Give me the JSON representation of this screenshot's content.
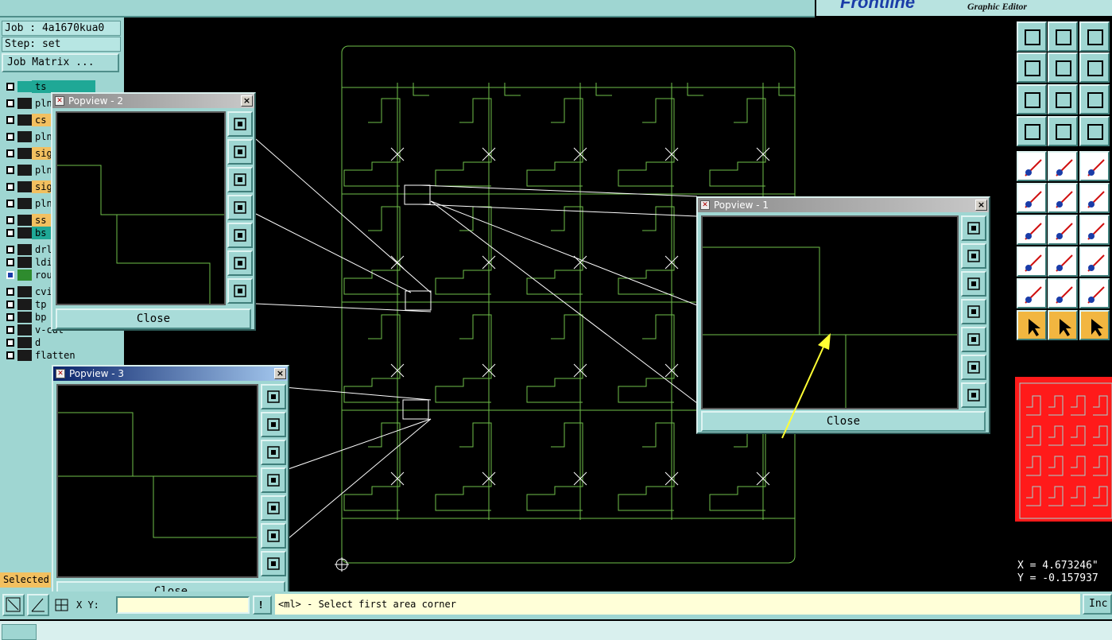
{
  "app": {
    "brand_logo": "Frontline",
    "brand_subtitle": "Graphic Editor"
  },
  "job": {
    "job_line": "Job : 4a1670kua0",
    "step_line": "Step: set",
    "matrix_button": "Job Matrix ..."
  },
  "layers": [
    {
      "name": "ts",
      "swatch": "#1fa896",
      "bg": "#1fa896",
      "checked": false
    },
    {
      "name": "pln",
      "swatch": "#1a1a1a",
      "bg": "#9fd6d2",
      "checked": false
    },
    {
      "name": "cs",
      "swatch": "#1a1a1a",
      "bg": "#f2c060",
      "checked": false
    },
    {
      "name": "pln",
      "swatch": "#1a1a1a",
      "bg": "#9fd6d2",
      "checked": false
    },
    {
      "name": "sig",
      "swatch": "#1a1a1a",
      "bg": "#f2c060",
      "checked": false
    },
    {
      "name": "pln",
      "swatch": "#1a1a1a",
      "bg": "#9fd6d2",
      "checked": false
    },
    {
      "name": "sig",
      "swatch": "#1a1a1a",
      "bg": "#f2c060",
      "checked": false
    },
    {
      "name": "pln",
      "swatch": "#1a1a1a",
      "bg": "#9fd6d2",
      "checked": false
    },
    {
      "name": "ss",
      "swatch": "#1a1a1a",
      "bg": "#f2c060",
      "checked": false
    },
    {
      "name": "bs",
      "swatch": "#1a1a1a",
      "bg": "#1fa896",
      "checked": false
    },
    {
      "name": "drl",
      "swatch": "#1a1a1a",
      "bg": "#9fd6d2",
      "checked": false
    },
    {
      "name": "ldi",
      "swatch": "#1a1a1a",
      "bg": "#9fd6d2",
      "checked": false
    },
    {
      "name": "rou",
      "swatch": "#2e8b2e",
      "bg": "#9fd6d2",
      "checked": true
    },
    {
      "name": "cvi",
      "swatch": "#1a1a1a",
      "bg": "#9fd6d2",
      "checked": false
    },
    {
      "name": "tp",
      "swatch": "#1a1a1a",
      "bg": "#9fd6d2",
      "checked": false
    },
    {
      "name": "bp",
      "swatch": "#1a1a1a",
      "bg": "#9fd6d2",
      "checked": false
    },
    {
      "name": "v-cut",
      "swatch": "#1a1a1a",
      "bg": "#9fd6d2",
      "checked": false
    },
    {
      "name": "d",
      "swatch": "#1a1a1a",
      "bg": "#9fd6d2",
      "checked": false
    },
    {
      "name": "flatten",
      "swatch": "#1a1a1a",
      "bg": "#9fd6d2",
      "checked": false
    }
  ],
  "selected_label": "Selected",
  "popups": [
    {
      "title": "Popview - 1",
      "close_label": "Close",
      "close_x": "×"
    },
    {
      "title": "Popview - 2",
      "close_label": "Close",
      "close_x": "×"
    },
    {
      "title": "Popview - 3",
      "close_label": "Close",
      "close_x": "×"
    }
  ],
  "coords": {
    "x": "X = 4.673246\"",
    "y": "Y = -0.157937"
  },
  "bottom": {
    "prompt": "<ml> - Select first area corner",
    "inc_label": "Inc",
    "xy_label": "X Y:"
  },
  "colors": {
    "panel": "#9fd6d2",
    "trace": "#6fbf4a",
    "annotation_arrow": "#ffff33",
    "minimap": "#ff1a1a"
  }
}
